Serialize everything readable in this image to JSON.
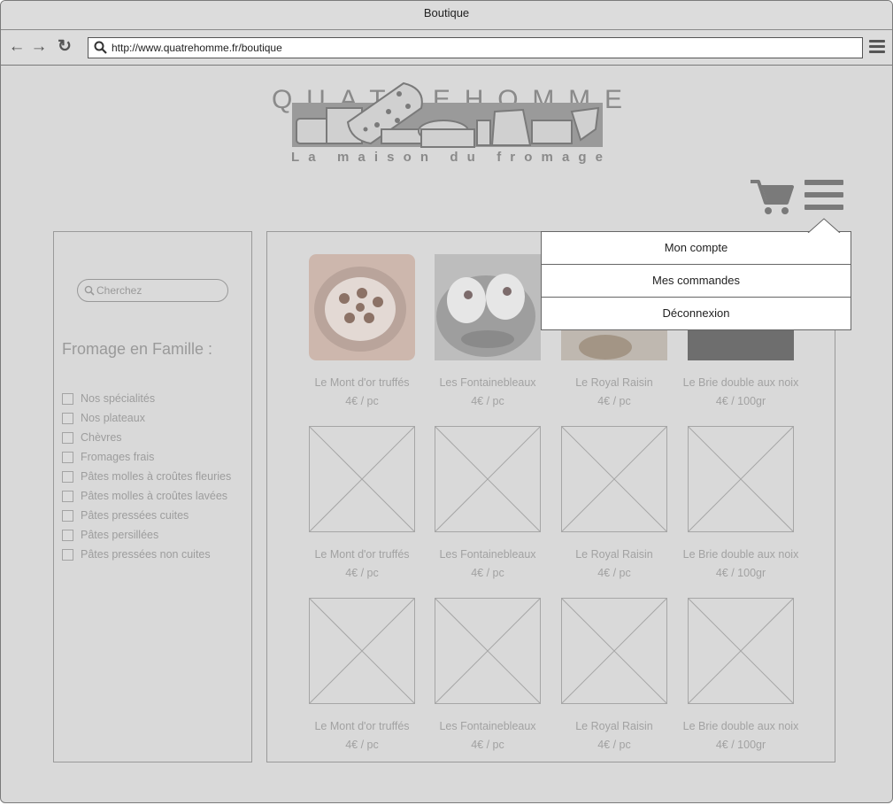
{
  "window": {
    "title": "Boutique"
  },
  "browser": {
    "url": "http://www.quatrehomme.fr/boutique"
  },
  "logo": {
    "brand": "QUATREHOMME",
    "tagline": "La maison du fromage"
  },
  "sidebar": {
    "search_placeholder": "Cherchez",
    "title": "Fromage en Famille :",
    "categories": [
      "Nos spécialités",
      "Nos plateaux",
      "Chèvres",
      "Fromages frais",
      "Pâtes molles à croûtes fleuries",
      "Pâtes molles à croûtes lavées",
      "Pâtes pressées cuites",
      "Pâtes persillées",
      "Pâtes pressées non cuites"
    ]
  },
  "products": [
    {
      "name": "Le Mont d'or truffés",
      "price": "4€ / pc"
    },
    {
      "name": "Les Fontainebleaux",
      "price": "4€ / pc"
    },
    {
      "name": "Le Royal Raisin",
      "price": "4€ / pc"
    },
    {
      "name": "Le Brie double aux noix",
      "price": "4€ / 100gr"
    },
    {
      "name": "Le Mont d'or truffés",
      "price": "4€ / pc"
    },
    {
      "name": "Les Fontainebleaux",
      "price": "4€ / pc"
    },
    {
      "name": "Le Royal Raisin",
      "price": "4€ / pc"
    },
    {
      "name": "Le Brie double aux noix",
      "price": "4€ / 100gr"
    },
    {
      "name": "Le Mont d'or truffés",
      "price": "4€ / pc"
    },
    {
      "name": "Les Fontainebleaux",
      "price": "4€ / pc"
    },
    {
      "name": "Le Royal Raisin",
      "price": "4€ / pc"
    },
    {
      "name": "Le Brie double aux noix",
      "price": "4€ / 100gr"
    }
  ],
  "account_menu": {
    "items": [
      "Mon compte",
      "Mes commandes",
      "Déconnexion"
    ]
  }
}
